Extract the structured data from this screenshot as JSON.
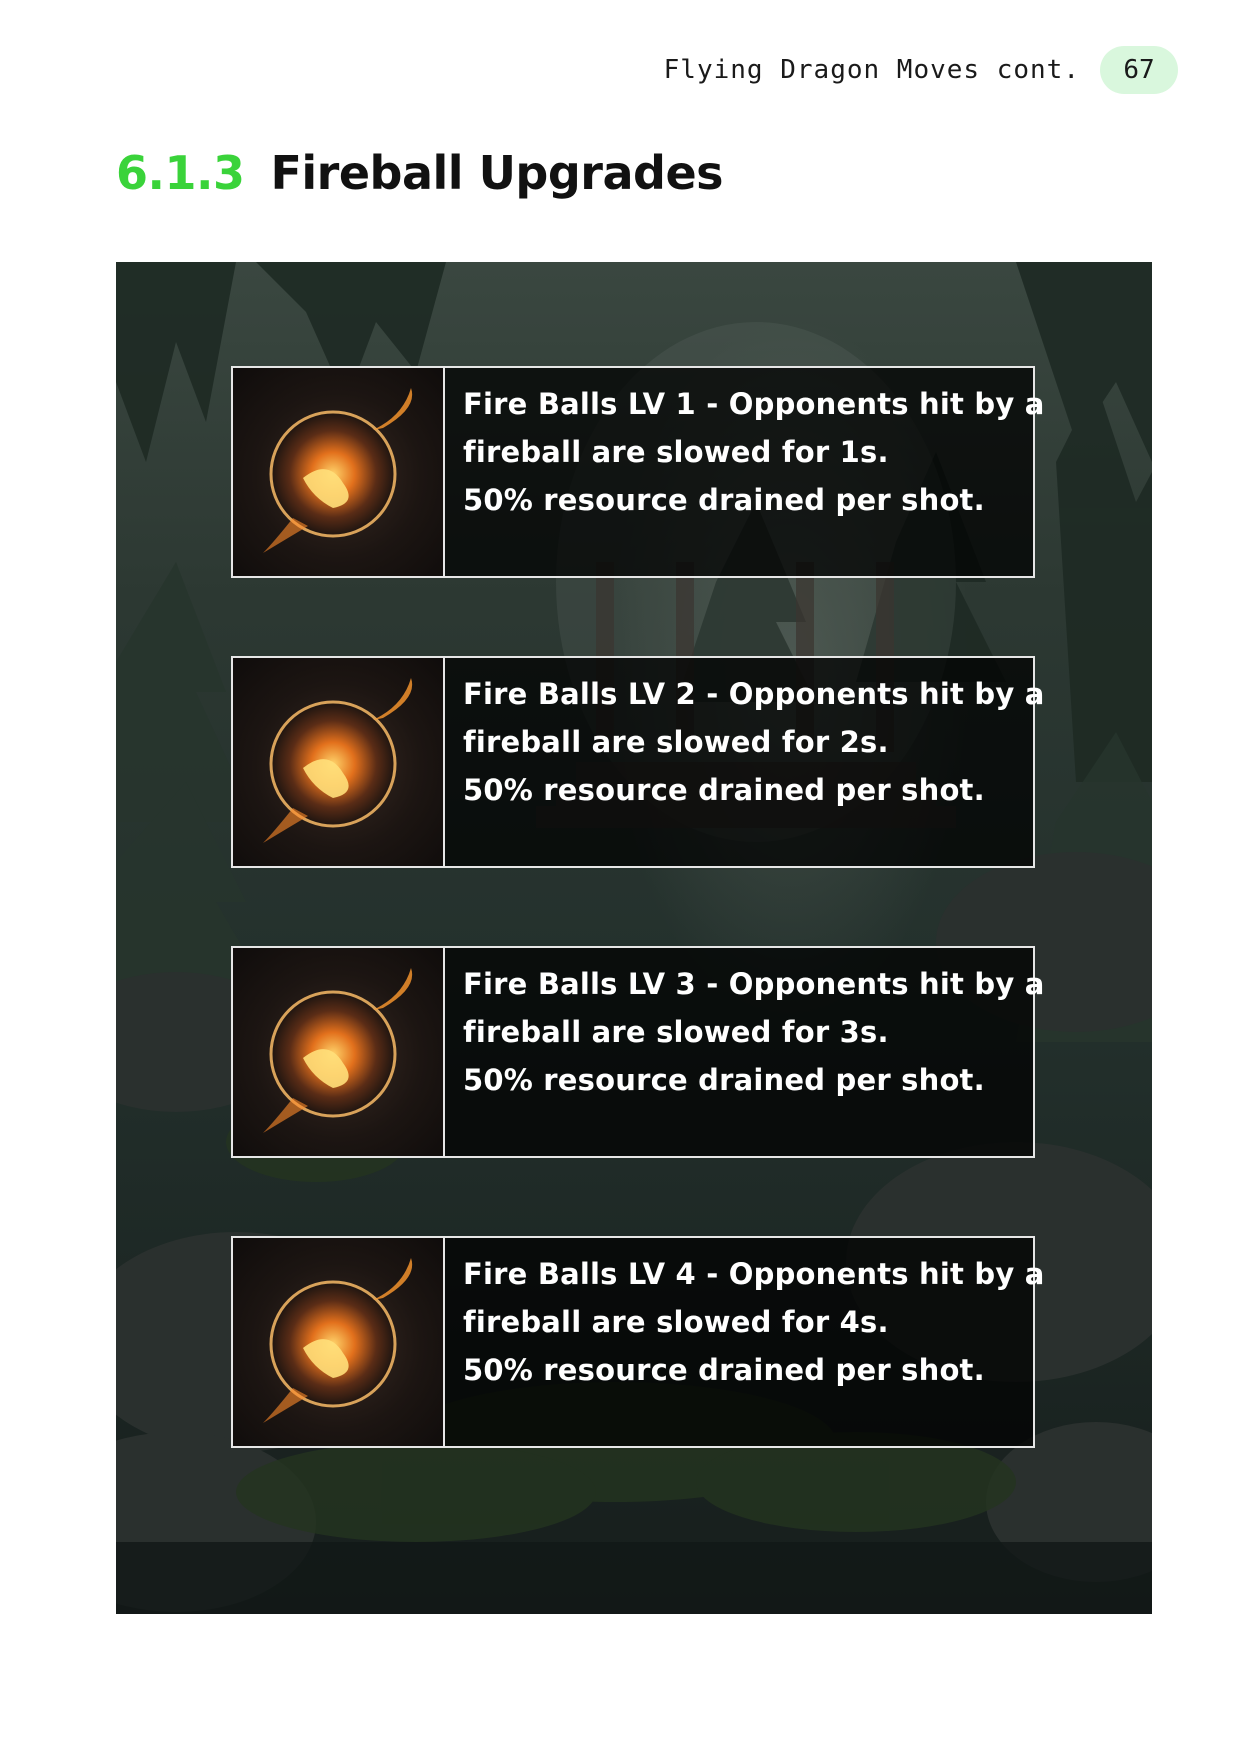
{
  "header": {
    "running_title": "Flying Dragon Moves cont.",
    "page_number": "67"
  },
  "section": {
    "number": "6.1.3",
    "title": "Fireball Upgrades"
  },
  "upgrades": [
    {
      "line1": "Fire Balls LV 1 - Opponents hit by a",
      "line2": "fireball are slowed for 1s.",
      "line3": "50% resource drained per shot.",
      "icon": "fireball-icon"
    },
    {
      "line1": "Fire Balls LV 2 - Opponents hit by a",
      "line2": "fireball are slowed for 2s.",
      "line3": "50% resource drained per shot.",
      "icon": "fireball-icon"
    },
    {
      "line1": "Fire Balls LV 3 - Opponents hit by a",
      "line2": "fireball are slowed for 3s.",
      "line3": "50% resource drained per shot.",
      "icon": "fireball-icon"
    },
    {
      "line1": "Fire Balls LV 4 - Opponents hit by a",
      "line2": "fireball are slowed for 4s.",
      "line3": "50% resource drained per shot.",
      "icon": "fireball-icon"
    }
  ],
  "colors": {
    "accent_green": "#3ad33a",
    "page_badge": "#d9f7dd",
    "card_border": "#e6e6e6"
  }
}
